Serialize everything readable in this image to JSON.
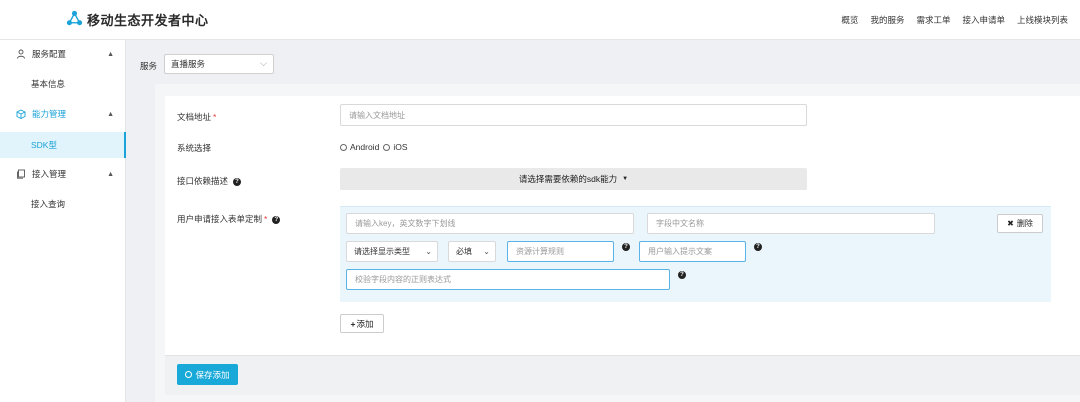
{
  "header": {
    "title": "移动生态开发者中心",
    "nav": [
      "概览",
      "我的服务",
      "需求工单",
      "接入申请单",
      "上线模块列表"
    ]
  },
  "sidebar": {
    "groups": [
      {
        "label": "服务配置",
        "icon": "user-icon",
        "items": [
          "基本信息"
        ]
      },
      {
        "label": "能力管理",
        "icon": "cube-icon",
        "items": [
          "SDK型"
        ]
      },
      {
        "label": "接入管理",
        "icon": "document-icon",
        "items": [
          "接入查询"
        ]
      }
    ]
  },
  "service": {
    "label": "服务",
    "selected": "直播服务"
  },
  "form": {
    "doc_label": "文档地址",
    "doc_placeholder": "请输入文档地址",
    "system_label": "系统选择",
    "system_options": [
      "Android",
      "iOS"
    ],
    "dep_label": "接口依赖描述",
    "dep_button": "请选择需要依赖的sdk能力",
    "custom_label": "用户申请接入表单定制",
    "key_placeholder": "请输入key，英文数字下划线",
    "cn_name_placeholder": "字段中文名称",
    "display_type": "请选择显示类型",
    "required": "必填",
    "calc_placeholder": "资源计算规则",
    "hint_placeholder": "用户输入提示文案",
    "regex_placeholder": "校验字段内容的正则表达式",
    "delete_button": "删除",
    "add_button": "添加",
    "save_button": "保存添加"
  },
  "colors": {
    "accent": "#1aa3d8",
    "required": "#e53935"
  }
}
